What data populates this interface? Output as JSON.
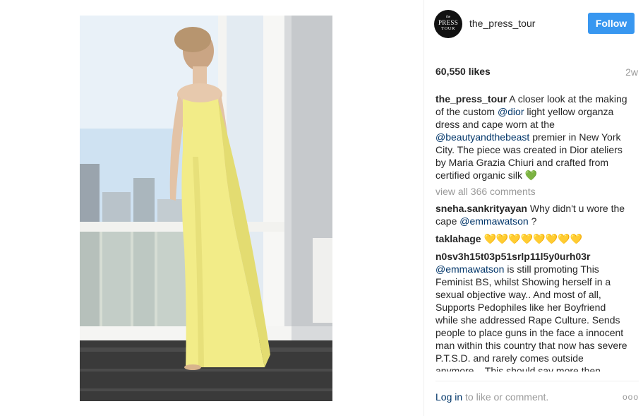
{
  "post": {
    "username": "the_press_tour",
    "avatar_text": {
      "top": "the",
      "middle": "PRESS",
      "bottom": "TOUR"
    },
    "follow_label": "Follow",
    "likes": "60,550 likes",
    "age": "2w",
    "caption": {
      "author": "the_press_tour",
      "parts": [
        {
          "text": " A closer look at the making of the custom ",
          "type": "text"
        },
        {
          "text": "@dior",
          "type": "mention"
        },
        {
          "text": " light yellow organza dress and cape worn at the ",
          "type": "text"
        },
        {
          "text": "@beautyandthebeast",
          "type": "mention"
        },
        {
          "text": " premier in New York City. The piece was created in Dior ateliers by Maria Grazia Chiuri and crafted from certified organic silk ",
          "type": "text"
        },
        {
          "text": "💚",
          "type": "heart"
        }
      ]
    },
    "view_all": "view all 366 comments",
    "comments": [
      {
        "author": "sneha.sankrityayan",
        "parts": [
          {
            "text": " Why didn't u wore the cape ",
            "type": "text"
          },
          {
            "text": "@emmawatson",
            "type": "mention"
          },
          {
            "text": " ?",
            "type": "text"
          }
        ]
      },
      {
        "author": "taklahage",
        "parts": [
          {
            "text": " 💛💛💛💛💛💛💛💛",
            "type": "hearts"
          }
        ]
      },
      {
        "author": "n0sv3h15t03p51srlp11l5y0urh03r",
        "parts": [
          {
            "text": " ",
            "type": "text"
          },
          {
            "text": "@emmawatson",
            "type": "mention"
          },
          {
            "text": " is still promoting This Feminist BS, whilst Showing herself in a sexual objective way.. And most of all, Supports Pedophiles like her Boyfriend while she addressed Rape Culture. Sends people to place guns in the face a innocent man within this country that now has severe P.T.S.D. and rarely comes outside anymore... This should say more then",
            "type": "text"
          }
        ]
      }
    ],
    "footer": {
      "login_link": "Log in",
      "login_rest": " to like or comment.",
      "more_label": "ooo"
    }
  }
}
